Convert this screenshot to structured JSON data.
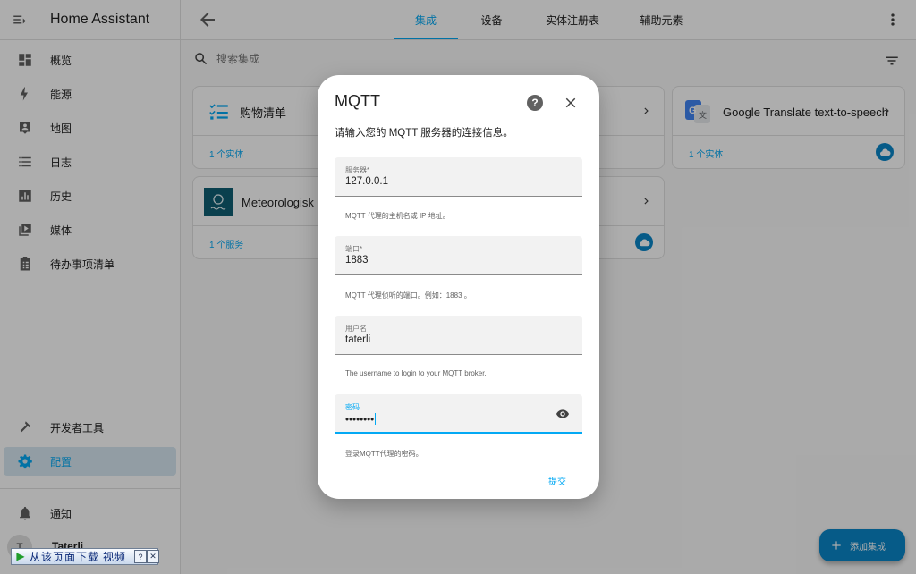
{
  "sidebar": {
    "title": "Home Assistant",
    "items": [
      {
        "label": "概览"
      },
      {
        "label": "能源"
      },
      {
        "label": "地图"
      },
      {
        "label": "日志"
      },
      {
        "label": "历史"
      },
      {
        "label": "媒体"
      },
      {
        "label": "待办事项清单"
      }
    ],
    "dev_tools_label": "开发者工具",
    "config_label": "配置",
    "notifications_label": "通知",
    "user_initial": "T",
    "user_name": "Taterli"
  },
  "topbar": {
    "tabs": [
      {
        "label": "集成",
        "active": true
      },
      {
        "label": "设备"
      },
      {
        "label": "实体注册表"
      },
      {
        "label": "辅助元素"
      }
    ]
  },
  "search": {
    "placeholder": "搜索集成"
  },
  "cards": [
    {
      "title": "购物清单",
      "footer": "1 个实体"
    },
    {
      "title": "Google Translate text-to-speech",
      "footer": "1 个实体"
    },
    {
      "title": "Meteorologisk",
      "footer": "1 个服务"
    }
  ],
  "dialog": {
    "title": "MQTT",
    "help_label": "?",
    "description": "请输入您的 MQTT 服务器的连接信息。",
    "fields": [
      {
        "label": "服务器*",
        "value": "127.0.0.1",
        "helper": "MQTT 代理的主机名或 IP 地址。"
      },
      {
        "label": "端口*",
        "value": "1883",
        "helper": "MQTT 代理侦听的端口。例如：1883 。"
      },
      {
        "label": "用户名",
        "value": "taterli",
        "helper": "The username to login to your MQTT broker."
      },
      {
        "label": "密码",
        "value": "••••••••",
        "helper": "登录MQTT代理的密码。"
      }
    ],
    "submit_label": "提交"
  },
  "fab": {
    "label": "添加集成"
  },
  "download_bar": {
    "text": "从该页面下载 视频",
    "help": "?",
    "close": "✕"
  },
  "colors": {
    "accent": "#03a9f4",
    "fab": "#0a86c9",
    "sidebar_active_bg": "#d8e8f2"
  }
}
